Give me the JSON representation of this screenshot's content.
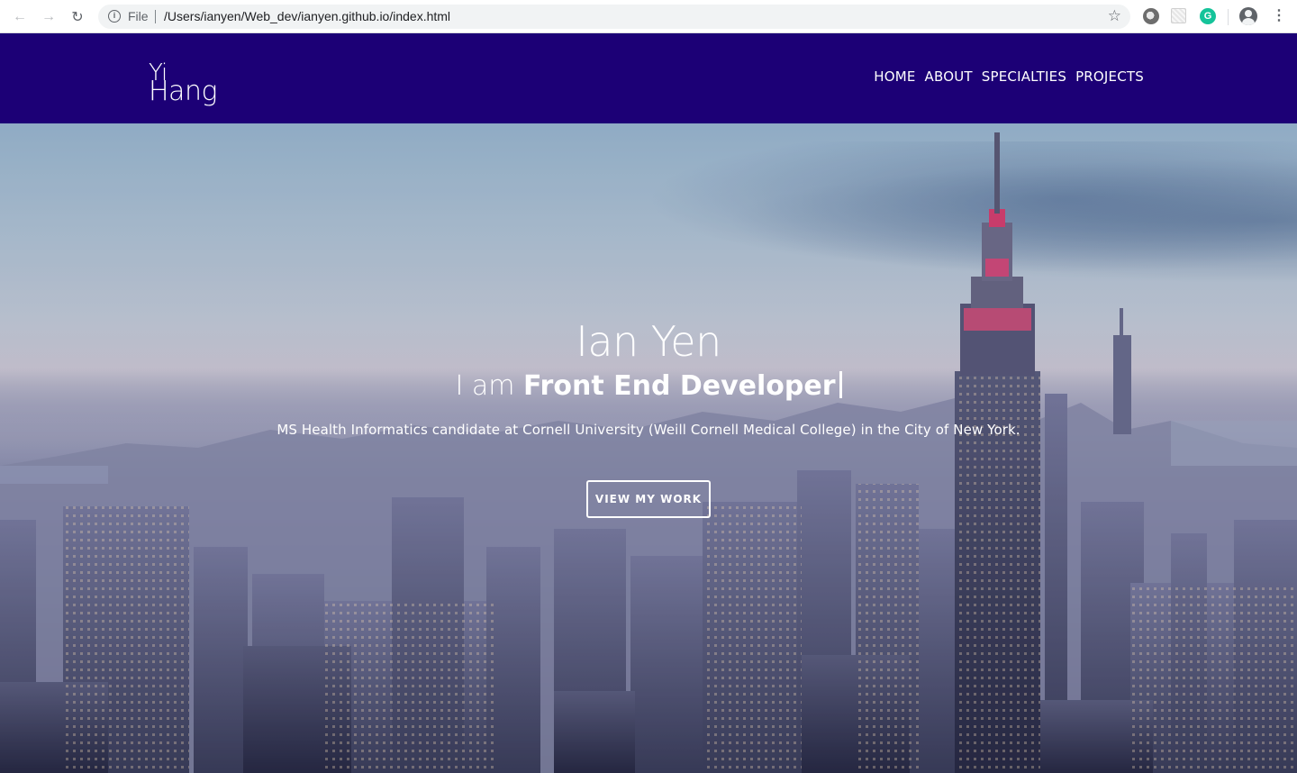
{
  "browser": {
    "back_icon": "arrow-left-icon",
    "forward_icon": "arrow-right-icon",
    "reload_icon": "reload-icon",
    "info_glyph": "i",
    "scheme": "File",
    "url": "/Users/ianyen/Web_dev/ianyen.github.io/index.html",
    "grammarly_glyph": "G"
  },
  "header": {
    "logo_line1": "Yi",
    "logo_line2": "Hang",
    "bg_color": "#1c0076",
    "nav": [
      {
        "label": "HOME"
      },
      {
        "label": "ABOUT"
      },
      {
        "label": "SPECIALTIES"
      },
      {
        "label": "PROJECTS"
      }
    ]
  },
  "hero": {
    "name": "Ian Yen",
    "role_prefix": "I am",
    "role_highlight": "Front End Developer",
    "description": "MS Health Informatics candidate at Cornell University (Weill Cornell Medical College) in the City of New York.",
    "cta_label": "VIEW MY WORK"
  }
}
